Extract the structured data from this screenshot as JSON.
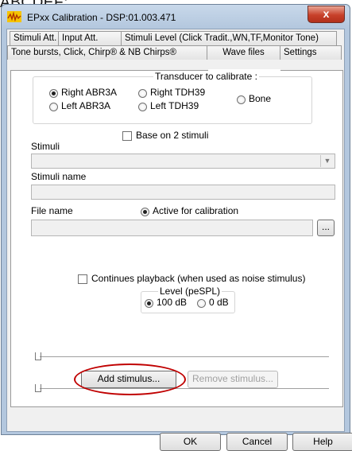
{
  "cropped_heading": "ABCDEF:",
  "window": {
    "title": "EPxx Calibration - DSP:01.003.471",
    "close_glyph": "x"
  },
  "tabs": {
    "row1": [
      "Stimuli Att.",
      "Input Att.",
      "Stimuli Level (Click Tradit.,WN,TF,Monitor Tone)"
    ],
    "row2": [
      "Tone bursts, Click, Chirp® & NB Chirps®",
      "Wave files",
      "Settings"
    ],
    "active": "Wave files"
  },
  "transducer": {
    "title": "Transducer to calibrate :",
    "options": [
      "Right ABR3A",
      "Right TDH39",
      "Left ABR3A",
      "Left TDH39",
      "Bone"
    ],
    "selected": "Right ABR3A"
  },
  "base_on_2_stimuli": {
    "label": "Base on 2 stimuli",
    "checked": false
  },
  "stimuli": {
    "label": "Stimuli",
    "value": ""
  },
  "stimuli_name": {
    "label": "Stimuli name",
    "value": ""
  },
  "file_name": {
    "label": "File name",
    "value": "",
    "browse_label": "..."
  },
  "active_for_calibration": {
    "label": "Active for calibration",
    "selected": true
  },
  "continues_playback": {
    "label": "Continues playback (when used as noise stimulus)",
    "checked": false
  },
  "level": {
    "title": "Level (peSPL)",
    "options": [
      "100 dB",
      "0 dB"
    ],
    "selected": "100 dB"
  },
  "buttons": {
    "add_stimulus": "Add stimulus...",
    "remove_stimulus": "Remove stimulus...",
    "ok": "OK",
    "cancel": "Cancel",
    "help": "Help"
  },
  "colors": {
    "highlight_ring": "#c00000",
    "close_button": "#c7412a"
  }
}
